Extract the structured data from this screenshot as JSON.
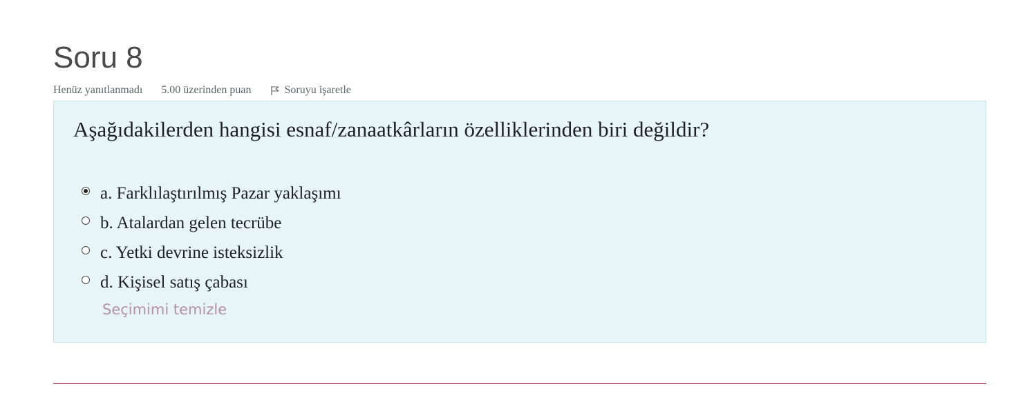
{
  "question": {
    "title": "Soru 8",
    "state": "Henüz yanıtlanmadı",
    "grade": "5.00 üzerinden puan",
    "flag_label": "Soruyu işaretle",
    "text": "Aşağıdakilerden hangisi esnaf/zanaatkârların özelliklerinden biri değildir?",
    "answers": [
      {
        "label": "a. Farklılaştırılmış Pazar yaklaşımı",
        "selected": true
      },
      {
        "label": "b. Atalardan gelen tecrübe",
        "selected": false
      },
      {
        "label": "c. Yetki devrine isteksizlik",
        "selected": false
      },
      {
        "label": "d. Kişisel satış çabası",
        "selected": false
      }
    ],
    "clear_label": "Seçimimi temizle"
  },
  "icons": {
    "flag": "flag-icon",
    "radio_selected": "radio-checked-icon",
    "radio_unselected": "radio-unchecked-icon"
  },
  "colors": {
    "content_background": "#e7f5f6",
    "content_border": "#c7e6ec",
    "clear_link": "#b491a4",
    "divider": "#a0344e"
  }
}
